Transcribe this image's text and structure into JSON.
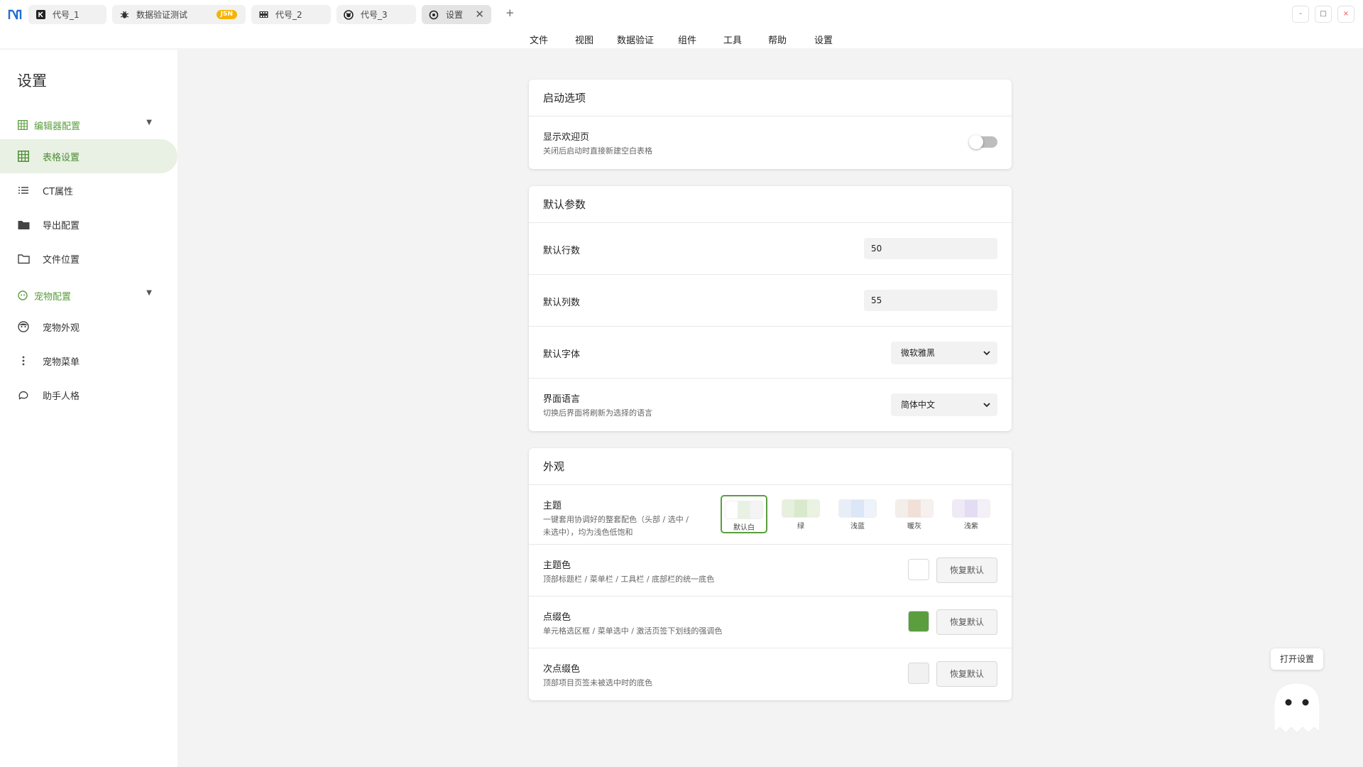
{
  "tabs": [
    {
      "label": "代号_1",
      "icon": "k-icon"
    },
    {
      "label": "数据验证测试",
      "icon": "bug-icon",
      "badge": "JSN"
    },
    {
      "label": "代号_2",
      "icon": "film-icon"
    },
    {
      "label": "代号_3",
      "icon": "github-icon"
    },
    {
      "label": "设置",
      "icon": "settings-icon",
      "active": true
    }
  ],
  "add_tab": "+",
  "window_controls": [
    "-",
    "□",
    "×"
  ],
  "menu": [
    "文件",
    "视图",
    "数据验证",
    "组件",
    "工具",
    "帮助",
    "设置"
  ],
  "sidebar": {
    "title": "设置",
    "group1": {
      "label": "编辑器配置",
      "caret": "▼"
    },
    "items1": [
      {
        "label": "表格设置",
        "icon": "grid-icon",
        "active": true
      },
      {
        "label": "CT属性",
        "icon": "list-icon"
      },
      {
        "label": "导出配置",
        "icon": "folder-filled-icon"
      },
      {
        "label": "文件位置",
        "icon": "folder-outline-icon"
      }
    ],
    "group2": {
      "label": "宠物配置",
      "caret": "▼"
    },
    "items2": [
      {
        "label": "宠物外观",
        "icon": "face-icon"
      },
      {
        "label": "宠物菜单",
        "icon": "dots-vertical-icon"
      },
      {
        "label": "助手人格",
        "icon": "chat-icon"
      }
    ]
  },
  "startup": {
    "title": "启动选项",
    "welcome": {
      "title": "显示欢迎页",
      "desc": "关闭后启动时直接新建空白表格",
      "enabled": false
    }
  },
  "defaults": {
    "title": "默认参数",
    "rows": {
      "title": "默认行数",
      "value": "50"
    },
    "cols": {
      "title": "默认列数",
      "value": "55"
    },
    "font": {
      "title": "默认字体",
      "value": "微软雅黑",
      "arrow": "⌄"
    },
    "lang": {
      "title": "界面语言",
      "desc": "切换后界面将刷新为选择的语言",
      "value": "简体中文",
      "arrow": "⌄"
    }
  },
  "appearance": {
    "title": "外观",
    "theme": {
      "title": "主题",
      "desc1": "一键套用协调好的整套配色（头部 / 选中 /",
      "desc2": "未选中），均为浅色低饱和",
      "options": [
        {
          "label": "默认白",
          "colors": [
            "#ffffff",
            "#e9f1e4",
            "#f4f4f4"
          ],
          "selected": true
        },
        {
          "label": "绿",
          "colors": [
            "#e6f0dd",
            "#d8e9cc",
            "#eaf2e2"
          ]
        },
        {
          "label": "浅蓝",
          "colors": [
            "#e8eef8",
            "#dbe6f6",
            "#eef2fa"
          ]
        },
        {
          "label": "暖灰",
          "colors": [
            "#f3eeea",
            "#f0e0d8",
            "#f6f1ee"
          ]
        },
        {
          "label": "浅紫",
          "colors": [
            "#efeaf6",
            "#e4dcf2",
            "#f3f0f8"
          ]
        }
      ]
    },
    "primary": {
      "title": "主题色",
      "desc": "顶部标题栏 / 菜单栏 / 工具栏 / 底部栏的统一底色",
      "color": "#ffffff",
      "reset": "恢复默认"
    },
    "accent": {
      "title": "点缀色",
      "desc": "单元格选区框 / 菜单选中 / 激活页签下划线的强调色",
      "color": "#5a9e3e",
      "reset": "恢复默认"
    },
    "secondary": {
      "title": "次点缀色",
      "desc": "顶部项目页签未被选中时的底色",
      "color": "#f1f1f1",
      "reset": "恢复默认"
    }
  },
  "floating": {
    "open_settings": "打开设置"
  }
}
